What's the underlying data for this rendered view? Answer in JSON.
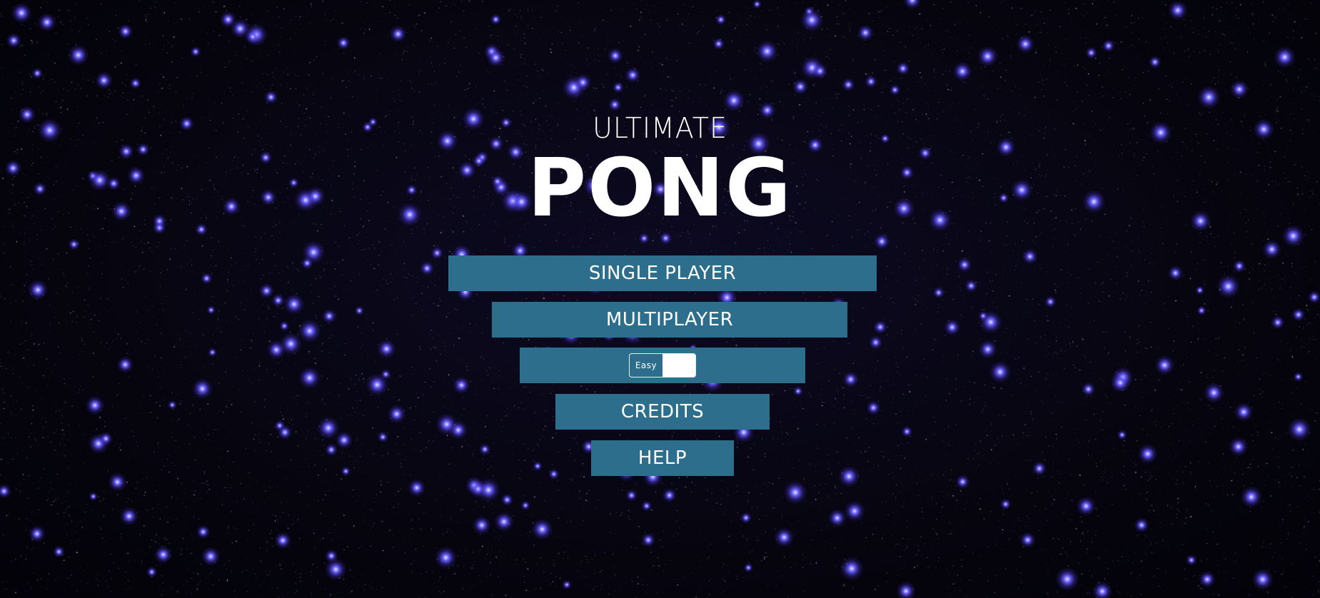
{
  "logo": {
    "top_word": "ULTIMATE",
    "main_word": "PONG"
  },
  "menu": {
    "single_player": "SINGLE PLAYER",
    "multiplayer": "MULTIPLAYER",
    "difficulty_label": "Easy",
    "credits": "CREDITS",
    "help": "HELP"
  },
  "colors": {
    "button": "#2c6e8b",
    "background": "#05040d",
    "star_blue": "#6b62ff",
    "text": "#ffffff"
  }
}
